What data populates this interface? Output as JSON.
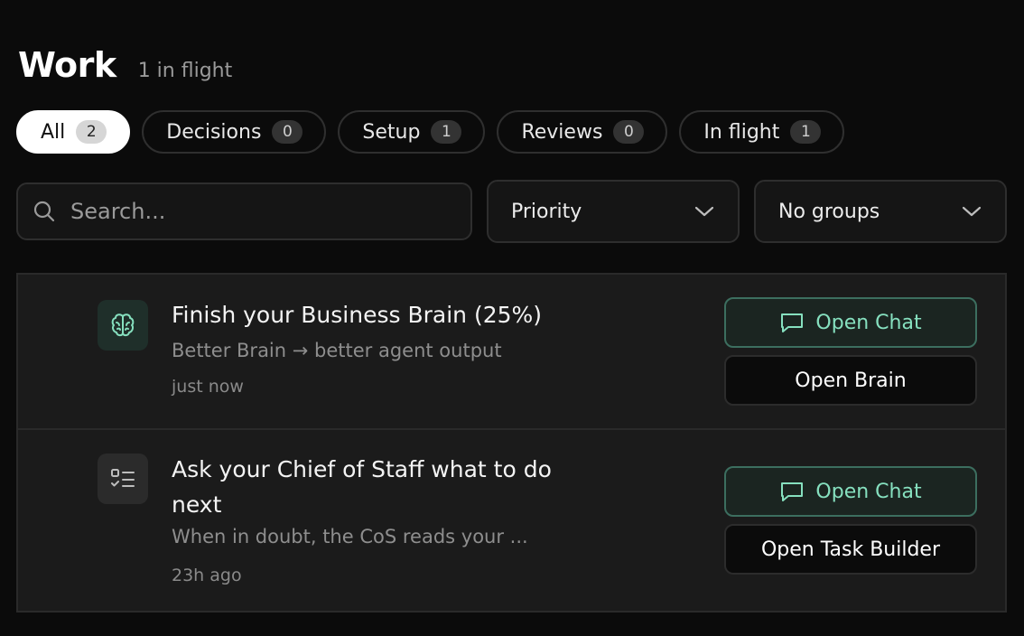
{
  "header": {
    "title": "Work",
    "subtitle": "1 in flight"
  },
  "tabs": [
    {
      "label": "All",
      "count": "2",
      "active": true
    },
    {
      "label": "Decisions",
      "count": "0"
    },
    {
      "label": "Setup",
      "count": "1"
    },
    {
      "label": "Reviews",
      "count": "0"
    },
    {
      "label": "In flight",
      "count": "1"
    }
  ],
  "search": {
    "placeholder": "Search...",
    "value": ""
  },
  "filters": {
    "sort": "Priority",
    "grouping": "No groups"
  },
  "items": [
    {
      "icon": "brain-icon",
      "title": "Finish your Business Brain (25%)",
      "progress_percent": 25,
      "description": "Better Brain → better agent output",
      "time": "just now",
      "primary_action": "Open Chat",
      "secondary_action": "Open Brain"
    },
    {
      "icon": "checklist-icon",
      "title": "Ask your Chief of Staff what to do next",
      "description": "When in doubt, the CoS reads your ...",
      "time": "23h ago",
      "primary_action": "Open Chat",
      "secondary_action": "Open Task Builder"
    }
  ],
  "colors": {
    "background": "#0b0b0b",
    "accent": "#86e0bf",
    "accent_border": "#3c6e5f"
  }
}
